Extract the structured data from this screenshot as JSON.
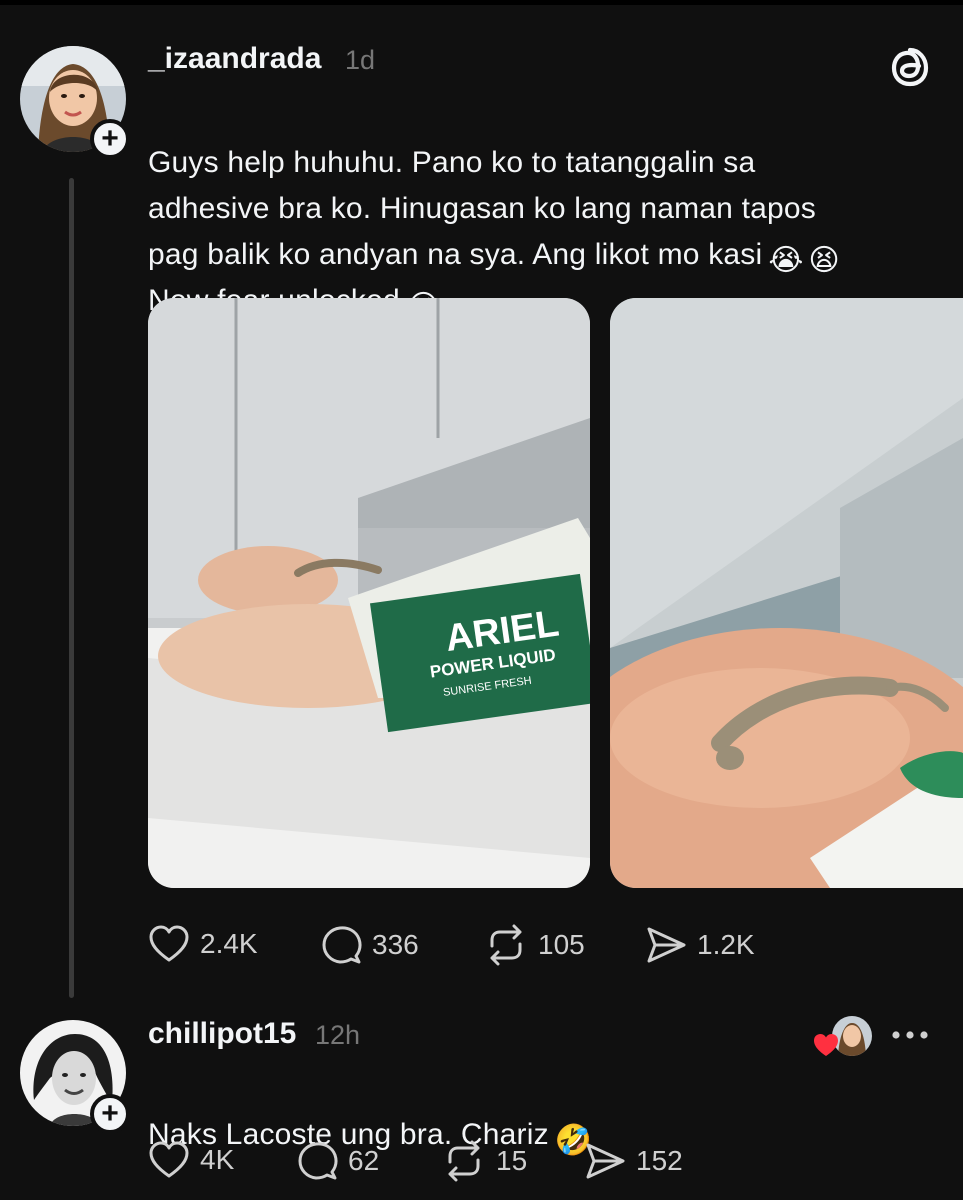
{
  "post": {
    "username": "_izaandrada",
    "time": "1d",
    "text": "Guys help huhuhu. Pano ko to tatanggalin sa\nadhesive bra ko. Hinugasan ko lang naman tapos\npag balik ko andyan na sya. Ang likot mo kasi",
    "text_line4": "New fear unlocked",
    "emoji_1": "😭",
    "emoji_2": "😫",
    "emoji_3": "😭",
    "images": [
      {
        "alt": "Adhesive bra with a gecko next to a detergent pouch",
        "pouch_brand": "ARIEL",
        "pouch_line": "POWER LIQUID",
        "pouch_variant": "SUNRISE FRESH"
      },
      {
        "alt": "Close-up of gecko on adhesive bra cup"
      }
    ],
    "actions": {
      "likes": "2.4K",
      "replies": "336",
      "reposts": "105",
      "shares": "1.2K"
    }
  },
  "reply": {
    "username": "chillipot15",
    "time": "12h",
    "text": "Naks Lacoste ung bra. Chariz",
    "emoji": "🤣",
    "actions": {
      "likes": "4K",
      "replies": "62",
      "reposts": "15",
      "shares": "152"
    }
  },
  "icons": {
    "app": "threads-logo-icon",
    "like": "heart-icon",
    "reply": "comment-icon",
    "repost": "repost-icon",
    "share": "send-icon",
    "more": "more-icon",
    "liked_by_author": "heart-filled-icon"
  },
  "colors": {
    "background": "#101010",
    "text": "#f3f5f7",
    "secondary": "#777777",
    "heart_red": "#ff3040"
  }
}
